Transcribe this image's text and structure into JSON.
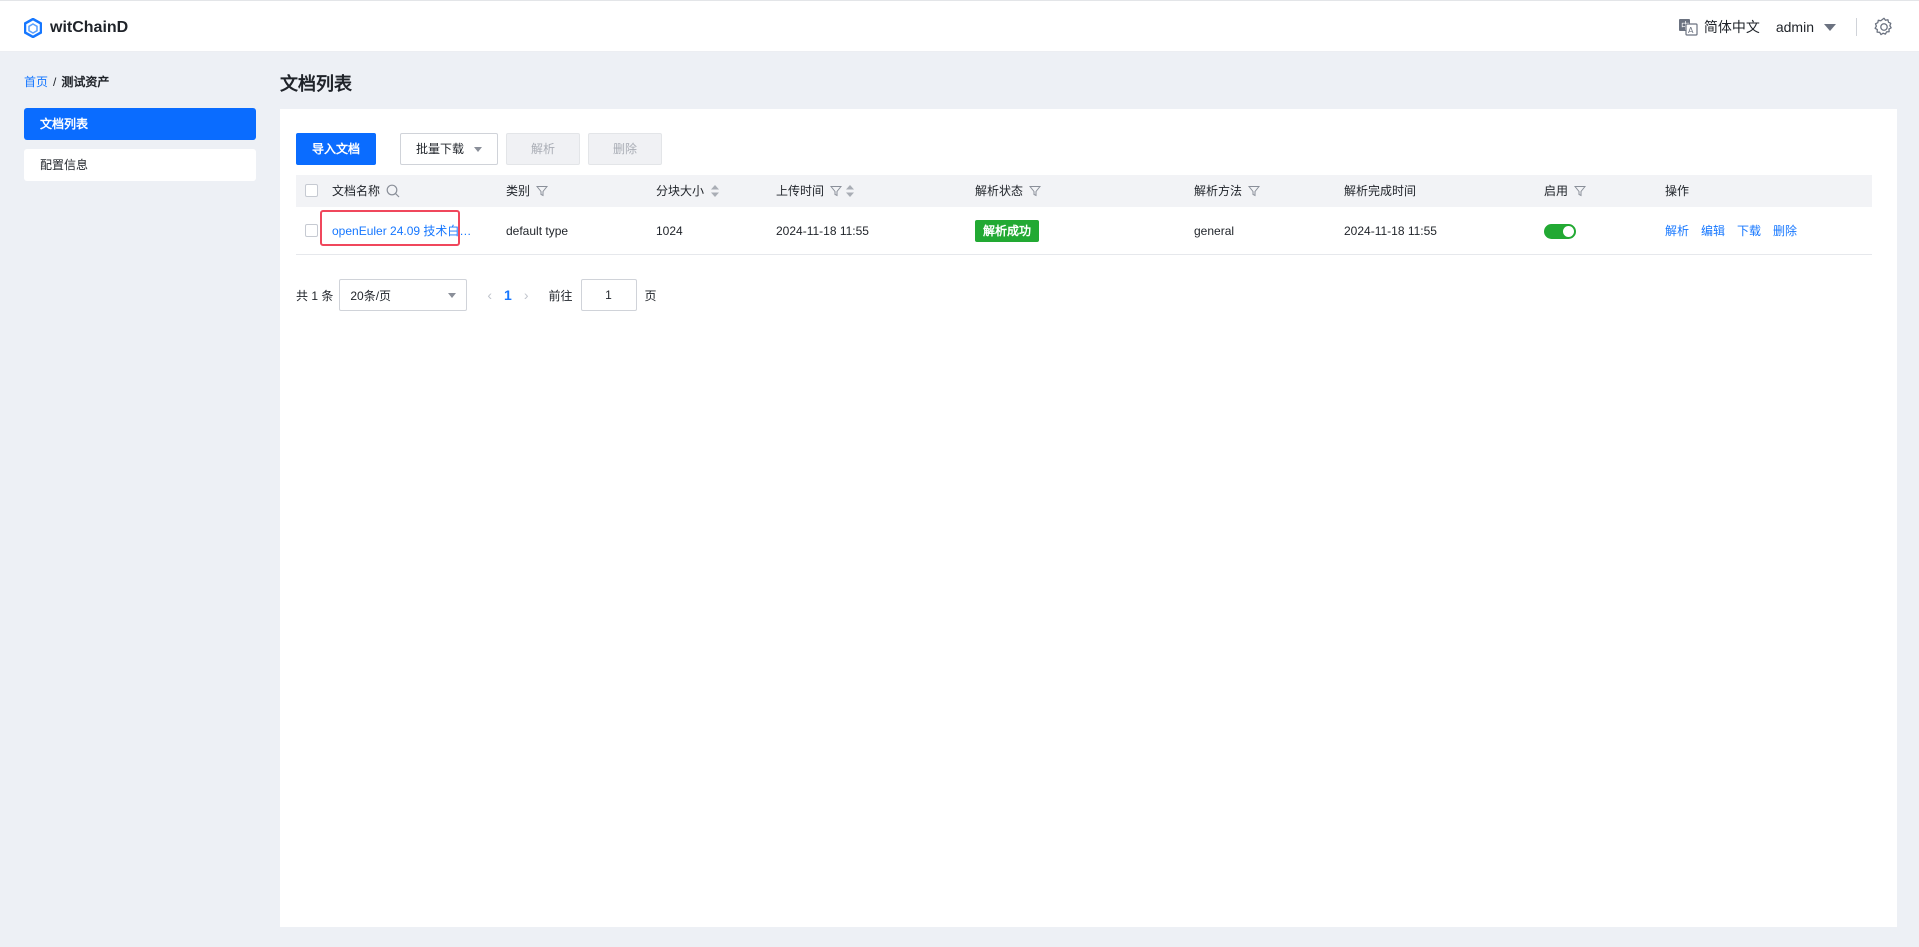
{
  "app": {
    "name": "witChainD"
  },
  "header": {
    "language": "简体中文",
    "user": "admin"
  },
  "breadcrumb": {
    "home": "首页",
    "separator": "/",
    "current": "测试资产"
  },
  "sidebar": {
    "items": [
      {
        "label": "文档列表",
        "active": true
      },
      {
        "label": "配置信息",
        "active": false
      }
    ]
  },
  "main": {
    "title": "文档列表",
    "toolbar": {
      "import_label": "导入文档",
      "batch_download_label": "批量下载",
      "parse_label": "解析",
      "delete_label": "删除"
    },
    "table": {
      "columns": [
        "文档名称",
        "类别",
        "分块大小",
        "上传时间",
        "解析状态",
        "解析方法",
        "解析完成时间",
        "启用",
        "操作"
      ],
      "rows": [
        {
          "name": "openEuler 24.09 技术白…",
          "category": "default type",
          "chunk_size": "1024",
          "upload_time": "2024-11-18 11:55",
          "status": "解析成功",
          "method": "general",
          "finish_time": "2024-11-18 11:55",
          "enabled": true,
          "actions": [
            "解析",
            "编辑",
            "下载",
            "删除"
          ]
        }
      ]
    },
    "pagination": {
      "total_label": "共 1 条",
      "page_size": "20条/页",
      "current_page": "1",
      "goto_label": "前往",
      "goto_value": "1",
      "page_suffix": "页"
    }
  },
  "colors": {
    "primary": "#0a6cff",
    "success": "#22a933",
    "highlight": "#f0475c",
    "background": "#edf0f5"
  }
}
